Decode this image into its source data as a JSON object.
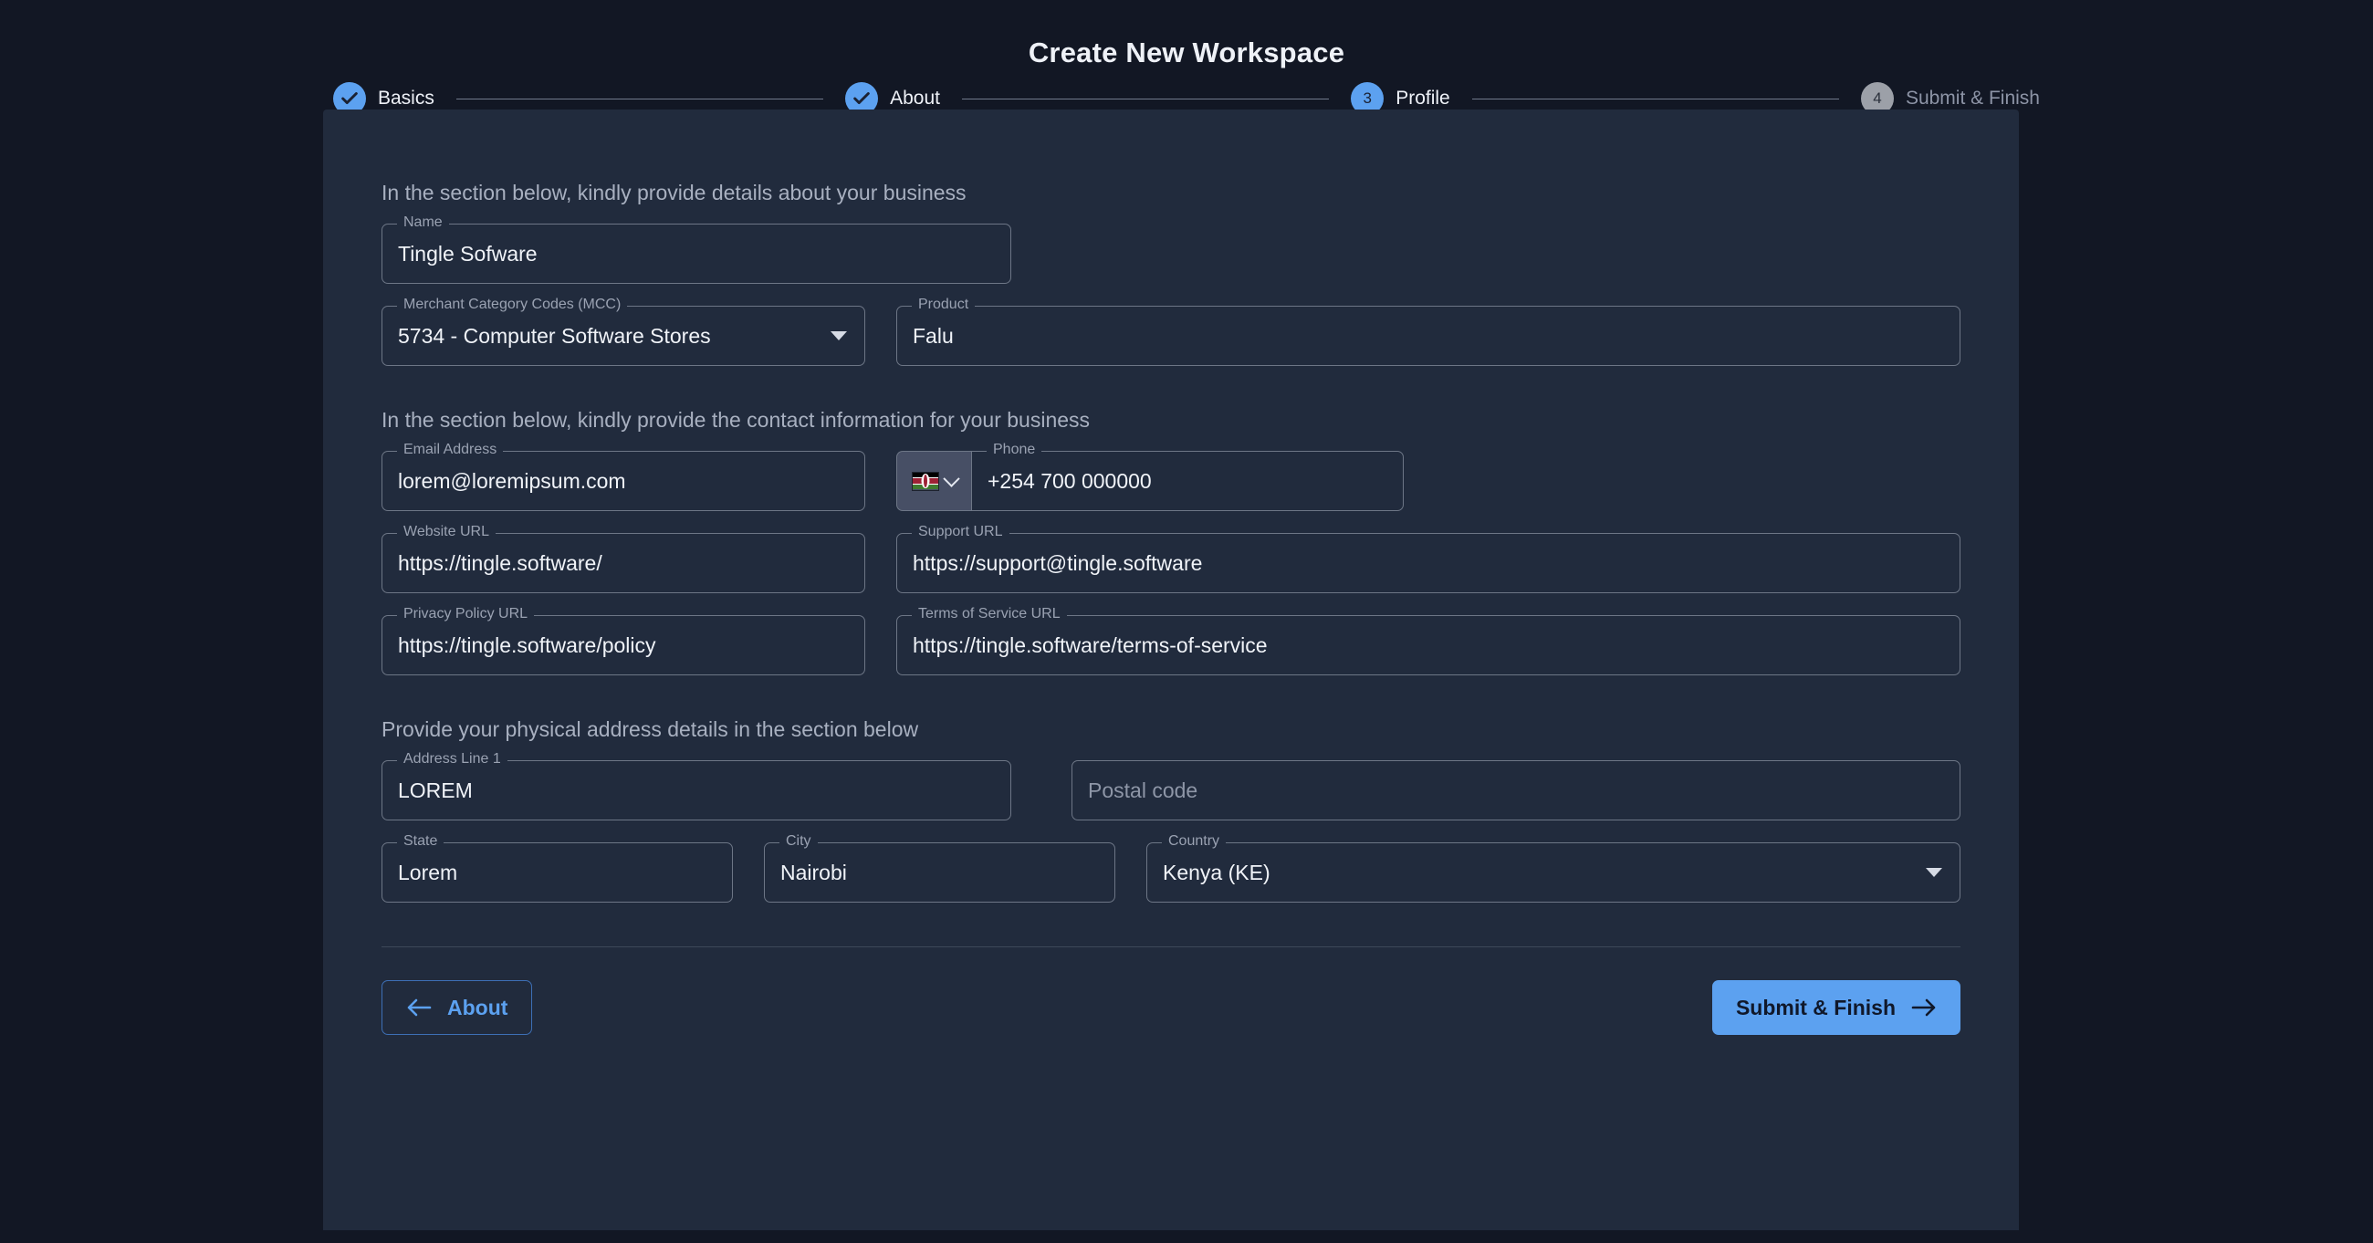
{
  "header": {
    "title": "Create New Workspace"
  },
  "stepper": {
    "steps": [
      {
        "label": "Basics",
        "marker": "check",
        "state": "done"
      },
      {
        "label": "About",
        "marker": "check",
        "state": "done"
      },
      {
        "label": "Profile",
        "marker": "3",
        "state": "active"
      },
      {
        "label": "Submit & Finish",
        "marker": "4",
        "state": "todo"
      }
    ]
  },
  "sections": {
    "business": {
      "heading": "In the section below, kindly provide details about your business",
      "name": {
        "label": "Name",
        "value": "Tingle Sofware"
      },
      "mcc": {
        "label": "Merchant Category Codes (MCC)",
        "value": "5734 - Computer Software Stores"
      },
      "product": {
        "label": "Product",
        "value": "Falu"
      }
    },
    "contact": {
      "heading": "In the section below, kindly provide the contact information for your business",
      "email": {
        "label": "Email Address",
        "value": "lorem@loremipsum.com"
      },
      "phone": {
        "label": "Phone",
        "value": "+254 700 000000",
        "country_flag": "kenya-flag"
      },
      "website": {
        "label": "Website URL",
        "value": "https://tingle.software/"
      },
      "support": {
        "label": "Support URL",
        "value": "https://support@tingle.software"
      },
      "privacy": {
        "label": "Privacy Policy URL",
        "value": "https://tingle.software/policy"
      },
      "terms": {
        "label": "Terms of Service URL",
        "value": "https://tingle.software/terms-of-service"
      }
    },
    "address": {
      "heading": "Provide your physical address details in the section below",
      "line1": {
        "label": "Address Line 1",
        "value": "LOREM"
      },
      "postal": {
        "placeholder": "Postal code",
        "value": ""
      },
      "state": {
        "label": "State",
        "value": "Lorem"
      },
      "city": {
        "label": "City",
        "value": "Nairobi"
      },
      "country": {
        "label": "Country",
        "value": "Kenya (KE)"
      }
    }
  },
  "footer": {
    "back_label": "About",
    "submit_label": "Submit & Finish"
  },
  "colors": {
    "page_background": "#121724",
    "card_background": "#212b3d",
    "accent": "#5ca1f0",
    "muted": "#9aa2b2",
    "border": "#6d7686",
    "step_todo": "#9ca0a8"
  }
}
